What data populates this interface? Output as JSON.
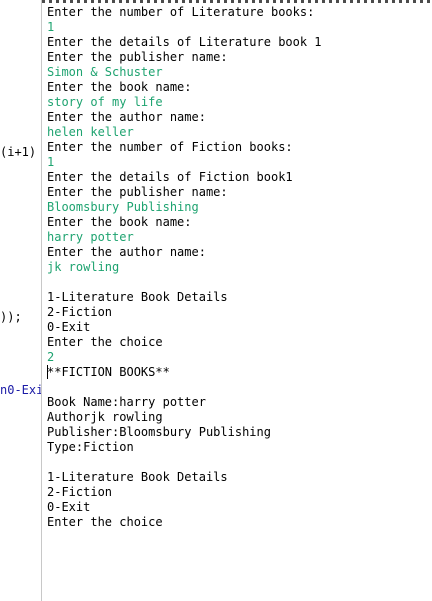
{
  "editor_fragments": [
    {
      "text": "(i+1)"
    },
    {
      "text": "));"
    },
    {
      "text": "n0-Exi"
    }
  ],
  "console": {
    "lines": [
      {
        "text": "Enter the number of Literature books:",
        "kind": "output"
      },
      {
        "text": "1",
        "kind": "input"
      },
      {
        "text": "Enter the details of Literature book 1",
        "kind": "output"
      },
      {
        "text": "Enter the publisher name:",
        "kind": "output"
      },
      {
        "text": "Simon & Schuster",
        "kind": "input"
      },
      {
        "text": "Enter the book name:",
        "kind": "output"
      },
      {
        "text": "story of my life",
        "kind": "input"
      },
      {
        "text": "Enter the author name:",
        "kind": "output"
      },
      {
        "text": "helen keller",
        "kind": "input"
      },
      {
        "text": "Enter the number of Fiction books:",
        "kind": "output"
      },
      {
        "text": "1",
        "kind": "input"
      },
      {
        "text": "Enter the details of Fiction book1",
        "kind": "output"
      },
      {
        "text": "Enter the publisher name:",
        "kind": "output"
      },
      {
        "text": "Bloomsbury Publishing",
        "kind": "input"
      },
      {
        "text": "Enter the book name:",
        "kind": "output"
      },
      {
        "text": "harry potter",
        "kind": "input"
      },
      {
        "text": "Enter the author name:",
        "kind": "output"
      },
      {
        "text": "jk rowling",
        "kind": "input"
      },
      {
        "text": "",
        "kind": "output"
      },
      {
        "text": "1-Literature Book Details",
        "kind": "output"
      },
      {
        "text": "2-Fiction",
        "kind": "output"
      },
      {
        "text": "0-Exit",
        "kind": "output"
      },
      {
        "text": "Enter the choice",
        "kind": "output"
      },
      {
        "text": "2",
        "kind": "input"
      },
      {
        "text": "**FICTION BOOKS**",
        "kind": "output"
      },
      {
        "text": "",
        "kind": "output"
      },
      {
        "text": "Book Name:harry potter",
        "kind": "output"
      },
      {
        "text": "Authorjk rowling",
        "kind": "output"
      },
      {
        "text": "Publisher:Bloomsbury Publishing",
        "kind": "output"
      },
      {
        "text": "Type:Fiction",
        "kind": "output"
      },
      {
        "text": "",
        "kind": "output"
      },
      {
        "text": "1-Literature Book Details",
        "kind": "output"
      },
      {
        "text": "2-Fiction",
        "kind": "output"
      },
      {
        "text": "0-Exit",
        "kind": "output"
      },
      {
        "text": "Enter the choice",
        "kind": "output"
      }
    ]
  },
  "colors": {
    "output_text": "#000000",
    "input_text": "#1ea370",
    "editor_fragment_highlight": "#1a1aa6",
    "background": "#ffffff",
    "divider": "#c8c8c8"
  }
}
